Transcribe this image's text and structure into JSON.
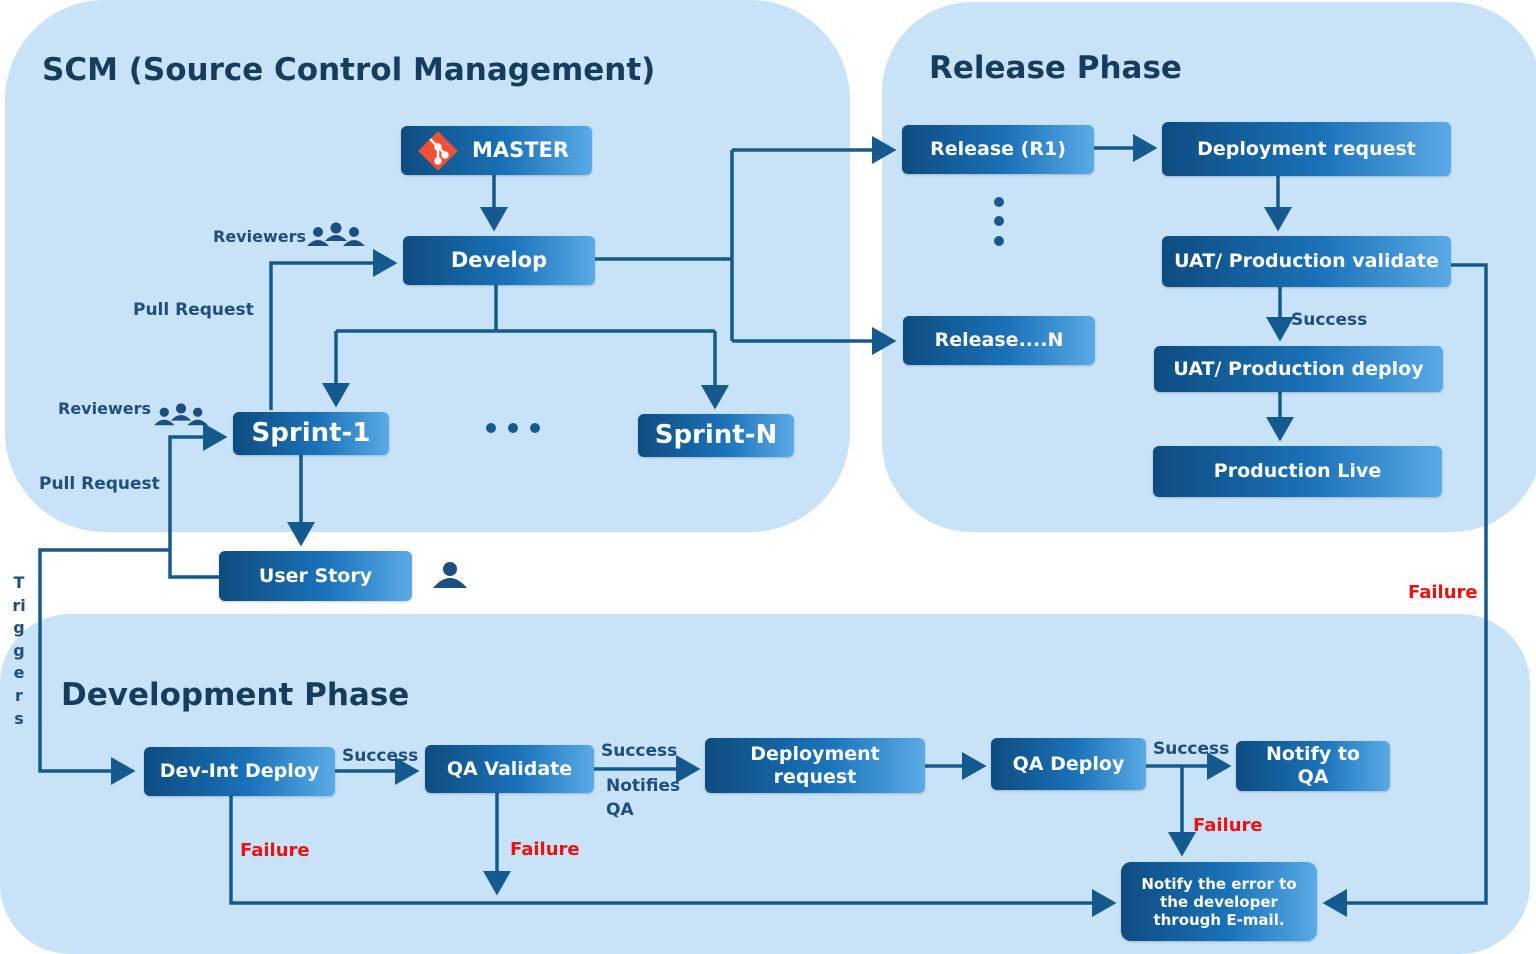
{
  "panels": {
    "scm": "SCM (Source Control Management)",
    "release": "Release Phase",
    "development": "Development Phase"
  },
  "scm": {
    "master": "MASTER",
    "develop": "Develop",
    "sprint1": "Sprint-1",
    "sprintN": "Sprint-N",
    "user_story": "User Story",
    "reviewers_top": "Reviewers",
    "pull_request_top": "Pull Request",
    "reviewers_left": "Reviewers",
    "pull_request_left": "Pull Request"
  },
  "release": {
    "release1": "Release (R1)",
    "releaseN": "Release....N",
    "deployment_request": "Deployment request",
    "uat_validate": "UAT/ Production validate",
    "success": "Success",
    "uat_deploy": "UAT/ Production deploy",
    "production_live": "Production Live",
    "failure": "Failure"
  },
  "development": {
    "triggers": "Triggers",
    "dev_int_deploy": "Dev-Int Deploy",
    "success1": "Success",
    "qa_validate": "QA Validate",
    "success2": "Success",
    "notifies_qa": "Notifies QA",
    "deployment_request": "Deployment request",
    "qa_deploy": "QA Deploy",
    "success3": "Success",
    "notify_qa": "Notify to QA",
    "failure1": "Failure",
    "failure2": "Failure",
    "failure3": "Failure",
    "notify_error": "Notify the error to the developer through E-mail."
  },
  "colors": {
    "panel": "#c8e3f8",
    "line": "#155a8f",
    "failure": "#ee1111",
    "title": "#163c5e"
  },
  "icons": [
    "git-icon",
    "reviewers-group-icon",
    "user-icon"
  ]
}
